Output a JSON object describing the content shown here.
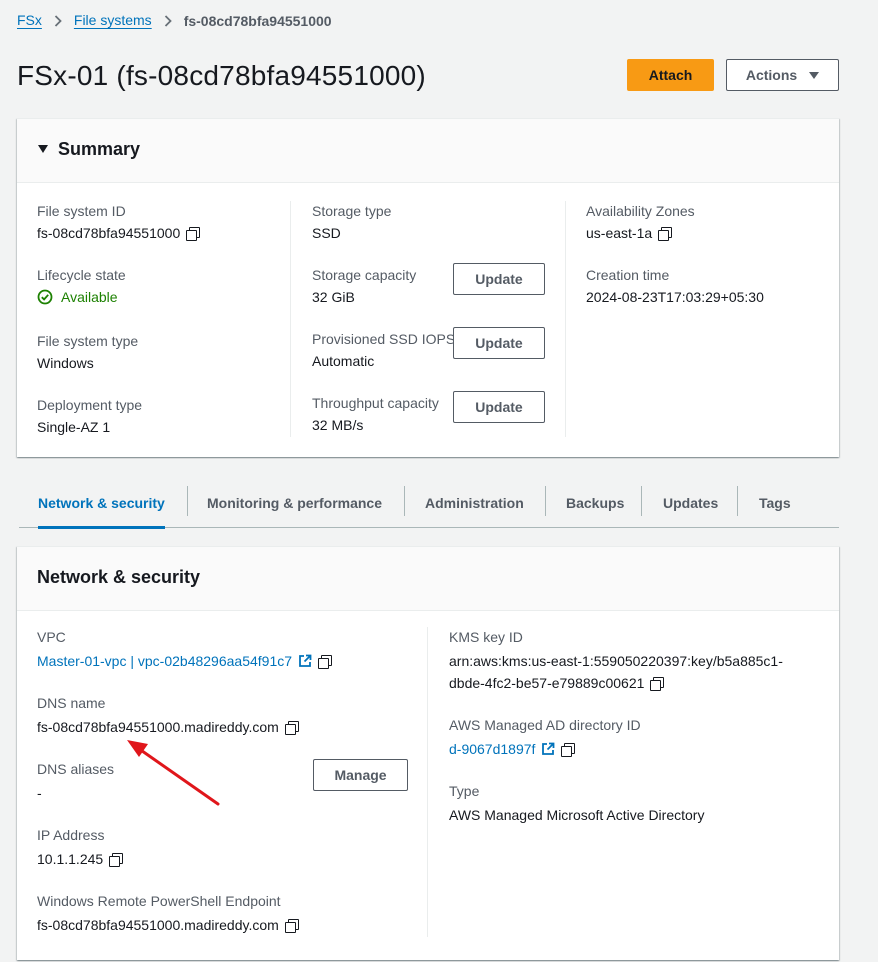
{
  "breadcrumb": {
    "items": [
      "FSx",
      "File systems"
    ],
    "current": "fs-08cd78bfa94551000"
  },
  "header": {
    "title": "FSx-01 (fs-08cd78bfa94551000)",
    "attach_label": "Attach",
    "actions_label": "Actions"
  },
  "summary": {
    "title": "Summary",
    "file_system_id": {
      "label": "File system ID",
      "value": "fs-08cd78bfa94551000"
    },
    "lifecycle_state": {
      "label": "Lifecycle state",
      "value": "Available"
    },
    "file_system_type": {
      "label": "File system type",
      "value": "Windows"
    },
    "deployment_type": {
      "label": "Deployment type",
      "value": "Single-AZ 1"
    },
    "storage_type": {
      "label": "Storage type",
      "value": "SSD"
    },
    "storage_capacity": {
      "label": "Storage capacity",
      "value": "32 GiB"
    },
    "provisioned_iops": {
      "label": "Provisioned SSD IOPS",
      "value": "Automatic"
    },
    "throughput_capacity": {
      "label": "Throughput capacity",
      "value": "32 MB/s"
    },
    "availability_zones": {
      "label": "Availability Zones",
      "value": "us-east-1a"
    },
    "creation_time": {
      "label": "Creation time",
      "value": "2024-08-23T17:03:29+05:30"
    },
    "update_label": "Update"
  },
  "tabs": [
    "Network & security",
    "Monitoring & performance",
    "Administration",
    "Backups",
    "Updates",
    "Tags"
  ],
  "network": {
    "title": "Network & security",
    "vpc": {
      "label": "VPC",
      "value": "Master-01-vpc | vpc-02b48296aa54f91c7"
    },
    "dns_name": {
      "label": "DNS name",
      "value": "fs-08cd78bfa94551000.madireddy.com"
    },
    "dns_aliases": {
      "label": "DNS aliases",
      "value": "-"
    },
    "manage_label": "Manage",
    "ip_address": {
      "label": "IP Address",
      "value": "10.1.1.245"
    },
    "powershell_endpoint": {
      "label": "Windows Remote PowerShell Endpoint",
      "value": "fs-08cd78bfa94551000.madireddy.com"
    },
    "kms_key_id": {
      "label": "KMS key ID",
      "value_line1": "arn:aws:kms:us-east-1:559050220397:key/b5a885c1-",
      "value_line2": "dbde-4fc2-be57-e79889c00621"
    },
    "ad_directory_id": {
      "label": "AWS Managed AD directory ID",
      "value": "d-9067d1897f"
    },
    "type": {
      "label": "Type",
      "value": "AWS Managed Microsoft Active Directory"
    }
  },
  "colors": {
    "accent": "#0073bb",
    "primary_button": "#f89a14",
    "success": "#1d8102",
    "annotation_arrow": "#e0161b"
  }
}
